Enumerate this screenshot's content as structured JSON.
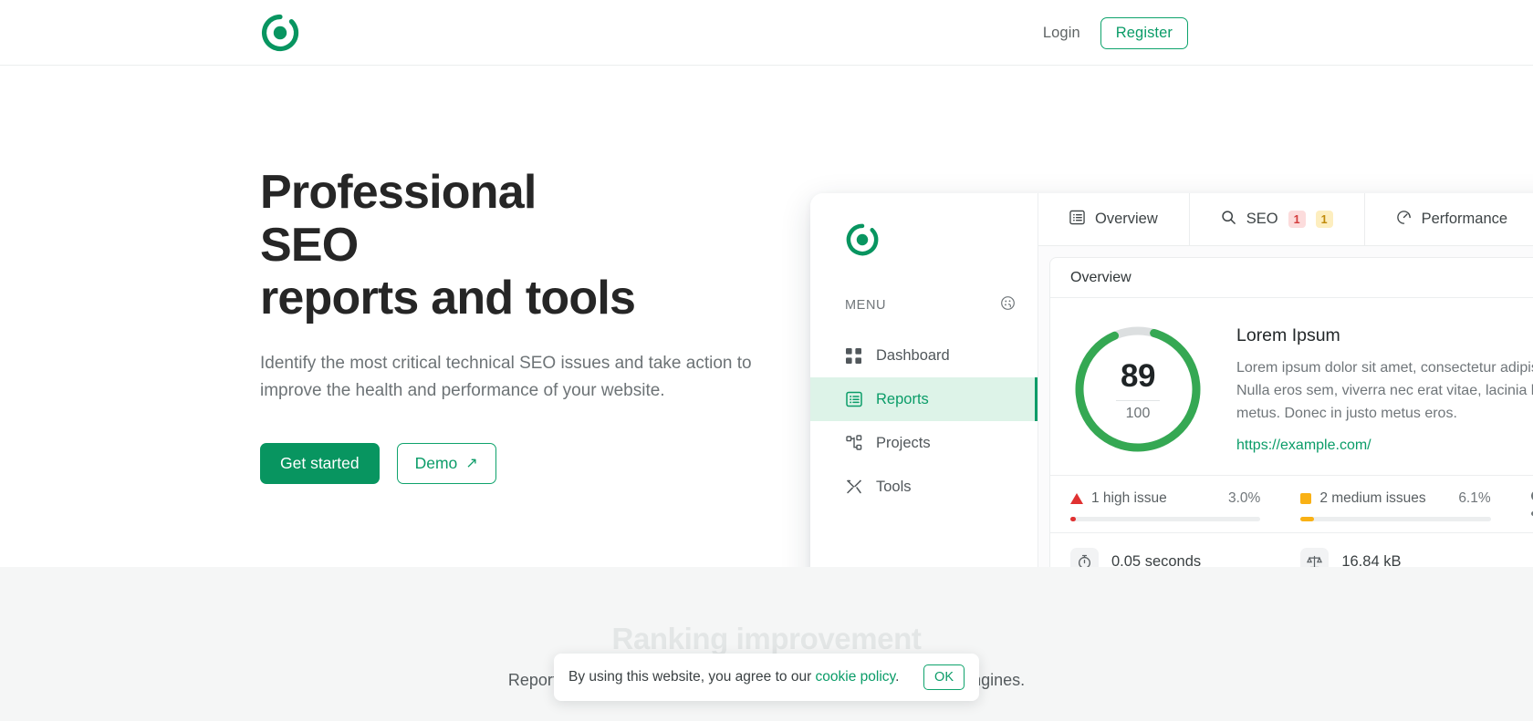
{
  "header": {
    "logo_icon": "target-ring-logo-icon",
    "login_label": "Login",
    "register_label": "Register"
  },
  "hero": {
    "title_line1": "Professional SEO",
    "title_line2": "reports and tools",
    "subtitle": "Identify the most critical technical SEO issues and take action to improve the health and performance of your website.",
    "primary_button": "Get started",
    "secondary_button": "Demo",
    "secondary_button_icon": "arrow-up-right-icon"
  },
  "mockup": {
    "sidebar": {
      "logo_icon": "target-ring-logo-icon",
      "menu_label": "MENU",
      "menu_action_icon": "palette-icon",
      "items": [
        {
          "label": "Dashboard",
          "icon": "grid-icon",
          "active": false
        },
        {
          "label": "Reports",
          "icon": "list-table-icon",
          "active": true
        },
        {
          "label": "Projects",
          "icon": "sitemap-icon",
          "active": false
        },
        {
          "label": "Tools",
          "icon": "tools-icon",
          "active": false
        }
      ]
    },
    "tabs": [
      {
        "label": "Overview",
        "icon": "list-table-icon",
        "badges": []
      },
      {
        "label": "SEO",
        "icon": "search-icon",
        "badges": [
          {
            "value": "1",
            "tone": "red"
          },
          {
            "value": "1",
            "tone": "yellow"
          }
        ]
      },
      {
        "label": "Performance",
        "icon": "gauge-icon",
        "badges": []
      }
    ],
    "panel": {
      "title": "Overview",
      "score": "89",
      "score_total": "100",
      "score_percent": 89,
      "site_title": "Lorem Ipsum",
      "site_desc": "Lorem ipsum dolor sit amet, consectetur adipiscing elit. Nulla eros sem, viverra nec erat vitae, lacinia hendrerit metus. Donec in justo metus eros.",
      "site_link": "https://example.com/",
      "issues": [
        {
          "icon": "triangle-warning-icon",
          "label": "1 high issue",
          "percent": "3.0%",
          "fill": 3,
          "color": "#e03131"
        },
        {
          "icon": "square-warning-icon",
          "label": "2 medium issues",
          "percent": "6.1%",
          "fill": 6.1,
          "color": "#f9b115"
        },
        {
          "icon": "circle-info-icon",
          "label": "",
          "percent": "",
          "fill": 8,
          "color": "#6f7679"
        }
      ],
      "metrics": [
        {
          "icon": "stopwatch-icon",
          "value": "0.05 seconds"
        },
        {
          "icon": "scales-icon",
          "value": "16.84 kB"
        }
      ]
    }
  },
  "lower": {
    "title": "Ranking improvement",
    "subtitle": "Reports that help you improve your presence on major search engines."
  },
  "cookie": {
    "text_before": "By using this website, you agree to our ",
    "link_label": "cookie policy",
    "text_after": ".",
    "ok_label": "OK"
  },
  "colors": {
    "brand_green": "#089560",
    "accent_green": "#0a9c68",
    "high_red": "#e03131",
    "medium_yellow": "#f9b115",
    "low_gray": "#6f7679"
  }
}
